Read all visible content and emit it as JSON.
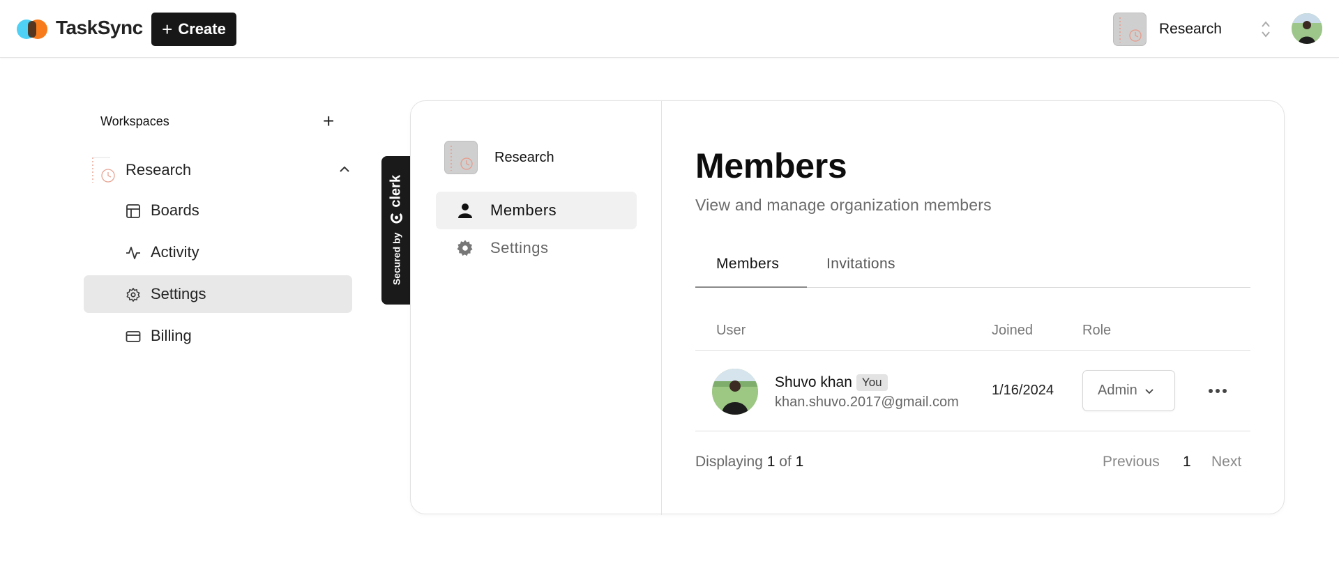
{
  "app": {
    "name": "TaskSync"
  },
  "navbar": {
    "create_label": "Create",
    "org_switcher": {
      "name": "Research"
    }
  },
  "sidebar": {
    "header": "Workspaces",
    "workspace": {
      "name": "Research"
    },
    "items": [
      {
        "label": "Boards",
        "icon": "layout-icon"
      },
      {
        "label": "Activity",
        "icon": "activity-icon"
      },
      {
        "label": "Settings",
        "icon": "gear-icon",
        "active": true
      },
      {
        "label": "Billing",
        "icon": "credit-card-icon"
      }
    ]
  },
  "clerk_badge": {
    "secured_by": "Secured by",
    "brand": "clerk"
  },
  "org_panel": {
    "org_name": "Research",
    "nav": [
      {
        "label": "Members",
        "icon": "person-icon",
        "active": true
      },
      {
        "label": "Settings",
        "icon": "gear-icon"
      }
    ]
  },
  "members_page": {
    "title": "Members",
    "subtitle": "View and manage organization members",
    "tabs": [
      "Members",
      "Invitations"
    ],
    "table": {
      "headers": {
        "user": "User",
        "joined": "Joined",
        "role": "Role"
      },
      "rows": [
        {
          "name": "Shuvo khan",
          "badge": "You",
          "email": "khan.shuvo.2017@gmail.com",
          "joined": "1/16/2024",
          "role": "Admin"
        }
      ]
    },
    "pagination": {
      "displaying_prefix": "Displaying",
      "current": "1",
      "of_word": "of",
      "total": "1",
      "previous": "Previous",
      "page": "1",
      "next": "Next"
    }
  }
}
